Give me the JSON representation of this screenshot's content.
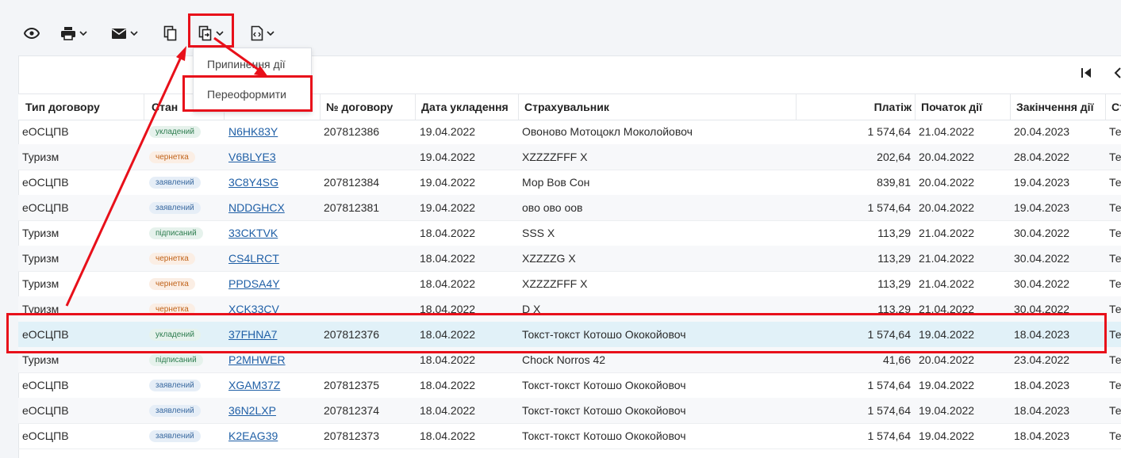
{
  "toolbar": {
    "icons": [
      "eye-icon",
      "printer-icon",
      "mail-icon",
      "copy-icon",
      "reissue-icon",
      "code-file-icon"
    ]
  },
  "dropdown": {
    "items": [
      "Припинення дії",
      "Переоформити"
    ]
  },
  "table": {
    "columns": [
      "Тип договору",
      "Стан",
      "",
      "№ договору",
      "Дата укладення",
      "Страхувальник",
      "Платіж",
      "Початок дії",
      "Закінчення дії",
      "Ст"
    ],
    "rows": [
      {
        "type": "еОСЦПВ",
        "status": "укладений",
        "code": "N6HK83Y",
        "number": "207812386",
        "date": "19.04.2022",
        "insurer": "Овоново Мотоцокл Моколойовоч",
        "payment": "1 574,64",
        "start": "21.04.2022",
        "end": "20.04.2023",
        "extra": "Те"
      },
      {
        "type": "Туризм",
        "status": "чернетка",
        "code": "V6BLYE3",
        "number": "",
        "date": "19.04.2022",
        "insurer": "XZZZZFFF X",
        "payment": "202,64",
        "start": "20.04.2022",
        "end": "28.04.2022",
        "extra": "Те"
      },
      {
        "type": "еОСЦПВ",
        "status": "заявлений",
        "code": "3C8Y4SG",
        "number": "207812384",
        "date": "19.04.2022",
        "insurer": "Мор Вов Сон",
        "payment": "839,81",
        "start": "20.04.2022",
        "end": "19.04.2023",
        "extra": "Те"
      },
      {
        "type": "еОСЦПВ",
        "status": "заявлений",
        "code": "NDDGHCX",
        "number": "207812381",
        "date": "19.04.2022",
        "insurer": "ово ово оов",
        "payment": "1 574,64",
        "start": "20.04.2022",
        "end": "19.04.2023",
        "extra": "Те"
      },
      {
        "type": "Туризм",
        "status": "підписаний",
        "code": "33CKTVK",
        "number": "",
        "date": "18.04.2022",
        "insurer": "SSS X",
        "payment": "113,29",
        "start": "21.04.2022",
        "end": "30.04.2022",
        "extra": "Те"
      },
      {
        "type": "Туризм",
        "status": "чернетка",
        "code": "CS4LRCT",
        "number": "",
        "date": "18.04.2022",
        "insurer": "XZZZZG X",
        "payment": "113,29",
        "start": "21.04.2022",
        "end": "30.04.2022",
        "extra": "Те"
      },
      {
        "type": "Туризм",
        "status": "чернетка",
        "code": "PPDSA4Y",
        "number": "",
        "date": "18.04.2022",
        "insurer": "XZZZZFFF X",
        "payment": "113,29",
        "start": "21.04.2022",
        "end": "30.04.2022",
        "extra": "Те"
      },
      {
        "type": "Туризм",
        "status": "чернетка",
        "code": "XCK33CV",
        "number": "",
        "date": "18.04.2022",
        "insurer": "D X",
        "payment": "113,29",
        "start": "21.04.2022",
        "end": "30.04.2022",
        "extra": "Те"
      },
      {
        "type": "еОСЦПВ",
        "status": "укладений",
        "code": "37FHNA7",
        "number": "207812376",
        "date": "18.04.2022",
        "insurer": "Токст-токст Котошо Ококойовоч",
        "payment": "1 574,64",
        "start": "19.04.2022",
        "end": "18.04.2023",
        "extra": "Те"
      },
      {
        "type": "Туризм",
        "status": "підписаний",
        "code": "P2MHWER",
        "number": "",
        "date": "18.04.2022",
        "insurer": "Chock Norros 42",
        "payment": "41,66",
        "start": "20.04.2022",
        "end": "23.04.2022",
        "extra": "Те"
      },
      {
        "type": "еОСЦПВ",
        "status": "заявлений",
        "code": "XGAM37Z",
        "number": "207812375",
        "date": "18.04.2022",
        "insurer": "Токст-токст Котошо Ококойовоч",
        "payment": "1 574,64",
        "start": "19.04.2022",
        "end": "18.04.2023",
        "extra": "Те"
      },
      {
        "type": "еОСЦПВ",
        "status": "заявлений",
        "code": "36N2LXP",
        "number": "207812374",
        "date": "18.04.2022",
        "insurer": "Токст-токст Котошо Ококойовоч",
        "payment": "1 574,64",
        "start": "19.04.2022",
        "end": "18.04.2023",
        "extra": "Те"
      },
      {
        "type": "еОСЦПВ",
        "status": "заявлений",
        "code": "K2EAG39",
        "number": "207812373",
        "date": "18.04.2022",
        "insurer": "Токст-токст Котошо Ококойовоч",
        "payment": "1 574,64",
        "start": "19.04.2022",
        "end": "18.04.2023",
        "extra": "Те"
      }
    ],
    "selected_row": 8
  },
  "colors": {
    "annotation": "#e8101a",
    "link": "#1f5fa6",
    "selected_row": "#e1f1f8"
  }
}
